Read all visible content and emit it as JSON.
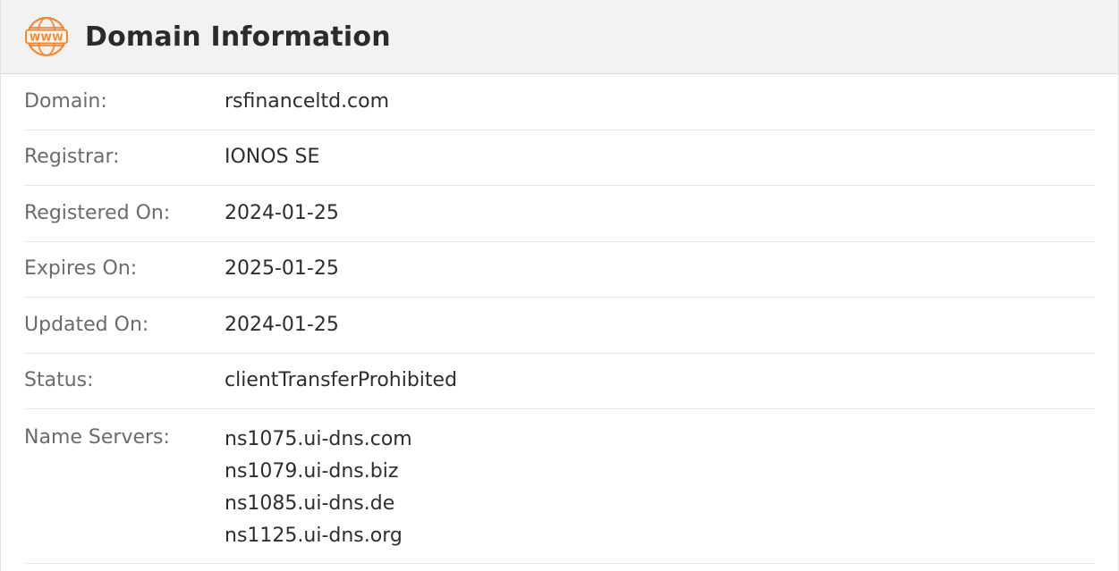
{
  "header": {
    "title": "Domain Information",
    "icon": "www-globe-icon",
    "icon_text": "WWW",
    "accent_color": "#f0893a"
  },
  "rows": [
    {
      "label": "Domain:",
      "value": "rsfinanceltd.com"
    },
    {
      "label": "Registrar:",
      "value": "IONOS SE"
    },
    {
      "label": "Registered On:",
      "value": "2024-01-25"
    },
    {
      "label": "Expires On:",
      "value": "2025-01-25"
    },
    {
      "label": "Updated On:",
      "value": "2024-01-25"
    },
    {
      "label": "Status:",
      "value": "clientTransferProhibited"
    }
  ],
  "name_servers": {
    "label": "Name Servers:",
    "values": [
      "ns1075.ui-dns.com",
      "ns1079.ui-dns.biz",
      "ns1085.ui-dns.de",
      "ns1125.ui-dns.org"
    ]
  }
}
